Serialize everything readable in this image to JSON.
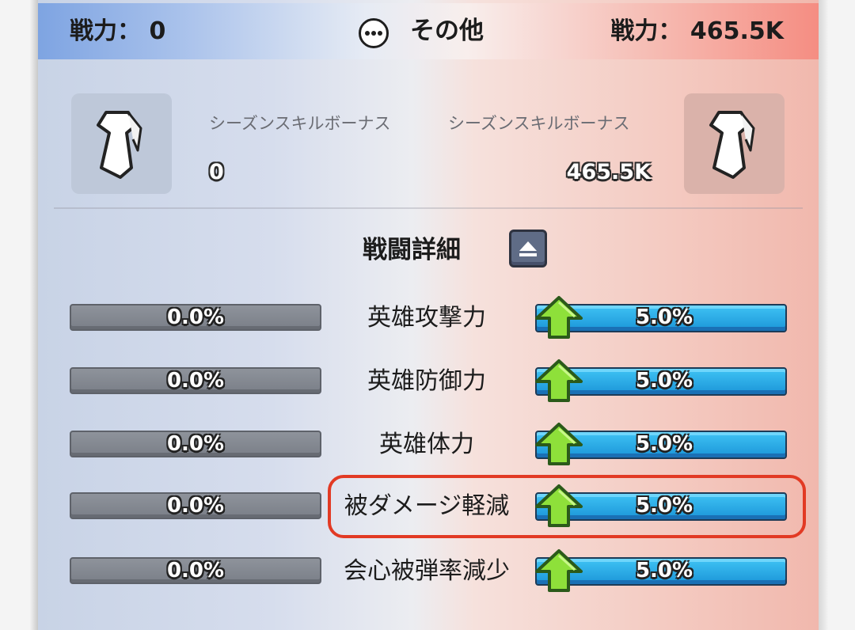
{
  "header": {
    "left_power_label": "戦力：",
    "left_power_value": "0",
    "center_title": "その他",
    "center_icon": "more-icon",
    "right_power_label": "戦力：",
    "right_power_value": "465.5K",
    "colors": {
      "left": "#7ea4e2",
      "right": "#f58d82"
    }
  },
  "season": {
    "left": {
      "icon": "tie-icon",
      "label": "シーズンスキルボーナス",
      "value": "0"
    },
    "right": {
      "icon": "tie-icon",
      "label": "シーズンスキルボーナス",
      "value": "465.5K"
    }
  },
  "details": {
    "title": "戦闘詳細",
    "toggle_icon": "collapse-up-icon",
    "rows": [
      {
        "label": "英雄攻撃力",
        "left_value": "0.0%",
        "right_value": "5.0%"
      },
      {
        "label": "英雄防御力",
        "left_value": "0.0%",
        "right_value": "5.0%"
      },
      {
        "label": "英雄体力",
        "left_value": "0.0%",
        "right_value": "5.0%"
      },
      {
        "label": "被ダメージ軽減",
        "left_value": "0.0%",
        "right_value": "5.0%",
        "highlighted": true
      },
      {
        "label": "会心被弾率減少",
        "left_value": "0.0%",
        "right_value": "5.0%"
      }
    ],
    "highlight_color": "#e23a24",
    "up_arrow_color": "#8ee03a"
  }
}
